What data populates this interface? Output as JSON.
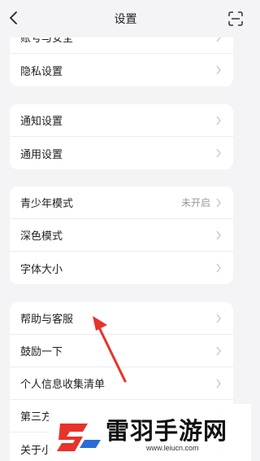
{
  "header": {
    "title": "设置",
    "back_icon": "chevron-left-icon",
    "scan_icon": "scan-icon"
  },
  "groups": [
    {
      "items": [
        {
          "label": "账号与安全"
        },
        {
          "label": "隐私设置"
        }
      ]
    },
    {
      "items": [
        {
          "label": "通知设置"
        },
        {
          "label": "通用设置"
        }
      ]
    },
    {
      "items": [
        {
          "label": "青少年模式",
          "value": "未开启"
        },
        {
          "label": "深色模式"
        },
        {
          "label": "字体大小"
        }
      ]
    },
    {
      "items": [
        {
          "label": "帮助与客服"
        },
        {
          "label": "鼓励一下"
        },
        {
          "label": "个人信息收集清单"
        },
        {
          "label": "第三方"
        },
        {
          "label": "关于小"
        }
      ]
    }
  ],
  "annotation": {
    "arrow_color": "#e8322b"
  },
  "watermark": {
    "text": "雷羽手游网",
    "url": "www.leiucn.com",
    "logo_color": "#e8322b"
  }
}
